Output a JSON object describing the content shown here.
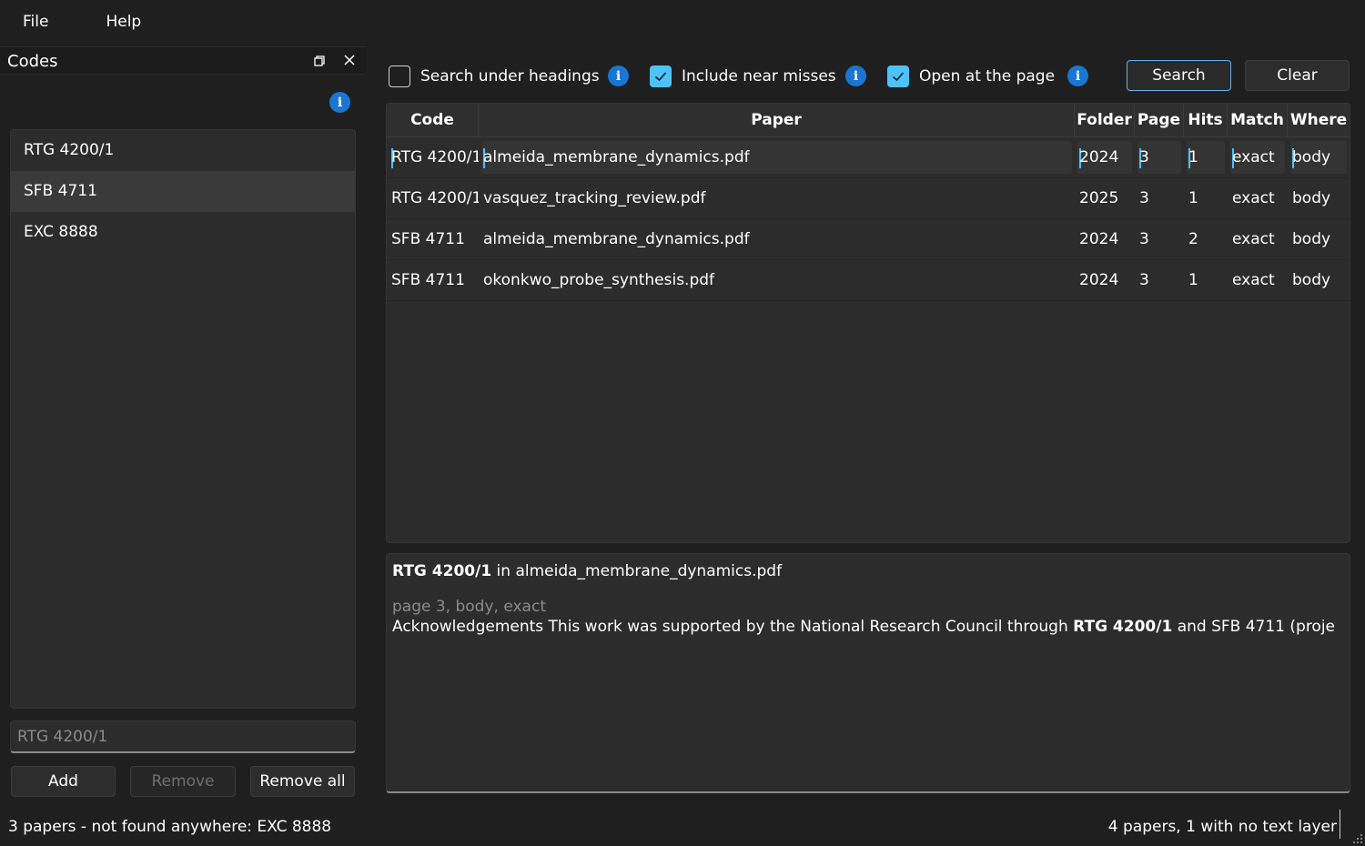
{
  "menu": {
    "file": "File",
    "help": "Help"
  },
  "codes_panel": {
    "title": "Codes",
    "items": [
      {
        "label": "RTG 4200/1",
        "selected": false
      },
      {
        "label": "SFB 4711",
        "selected": true
      },
      {
        "label": "EXC 8888",
        "selected": false
      }
    ],
    "input_placeholder": "RTG 4200/1",
    "add_label": "Add",
    "remove_label": "Remove",
    "remove_all_label": "Remove all"
  },
  "options": {
    "search_headings": {
      "label": "Search under headings",
      "checked": false
    },
    "near_misses": {
      "label": "Include near misses",
      "checked": true
    },
    "open_page": {
      "label": "Open at the page",
      "checked": true
    },
    "search_label": "Search",
    "clear_label": "Clear"
  },
  "table": {
    "headers": {
      "code": "Code",
      "paper": "Paper",
      "folder": "Folder",
      "page": "Page",
      "hits": "Hits",
      "match": "Match",
      "where": "Where"
    },
    "rows": [
      {
        "code": "RTG 4200/1",
        "paper": "almeida_membrane_dynamics.pdf",
        "folder": "2024",
        "page": "3",
        "hits": "1",
        "match": "exact",
        "where": "body"
      },
      {
        "code": "RTG 4200/1",
        "paper": "vasquez_tracking_review.pdf",
        "folder": "2025",
        "page": "3",
        "hits": "1",
        "match": "exact",
        "where": "body"
      },
      {
        "code": "SFB 4711",
        "paper": "almeida_membrane_dynamics.pdf",
        "folder": "2024",
        "page": "3",
        "hits": "2",
        "match": "exact",
        "where": "body"
      },
      {
        "code": "SFB 4711",
        "paper": "okonkwo_probe_synthesis.pdf",
        "folder": "2024",
        "page": "3",
        "hits": "1",
        "match": "exact",
        "where": "body"
      }
    ]
  },
  "preview": {
    "code": "RTG 4200/1",
    "in_word": " in ",
    "paper": "almeida_membrane_dynamics.pdf",
    "meta": "page 3, body, exact",
    "snippet_before": "Acknowledgements This work was supported by the National Research Council through ",
    "snippet_match": "RTG 4200/1",
    "snippet_after": " and SFB 4711 (proje"
  },
  "status": {
    "left": "3 papers - not found anywhere: EXC 8888",
    "right": "4 papers, 1 with no text layer"
  },
  "colors": {
    "accent": "#4cc2ff",
    "info": "#1976d2",
    "background": "#1f1f1f",
    "panel": "#2c2c2c"
  }
}
